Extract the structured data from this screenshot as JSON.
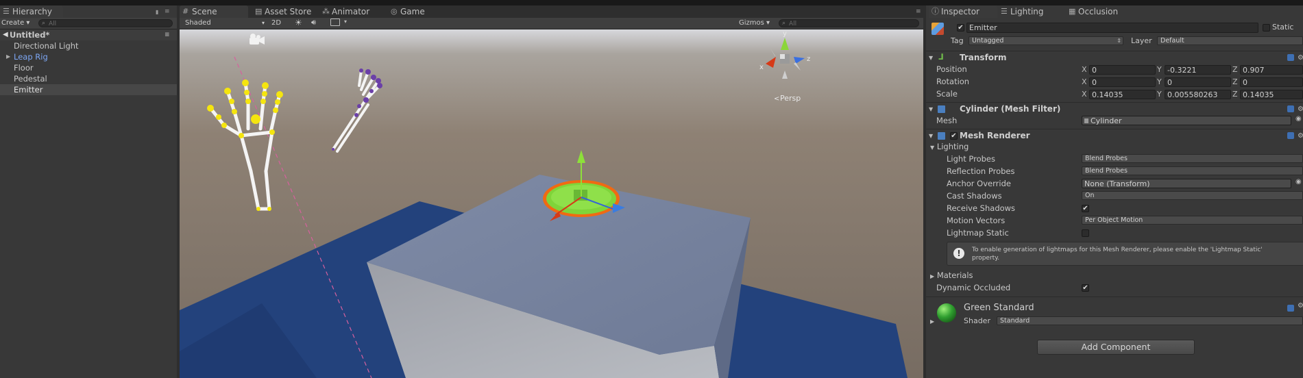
{
  "hierarchy": {
    "tab_label": "Hierarchy",
    "create_label": "Create",
    "search_placeholder": "All",
    "scene_name": "Untitled*",
    "items": [
      {
        "label": "Directional Light",
        "color": "#c8c8c8"
      },
      {
        "label": "Leap Rig",
        "color": "#7da7f5"
      },
      {
        "label": "Floor",
        "color": "#c8c8c8"
      },
      {
        "label": "Pedestal",
        "color": "#c8c8c8"
      },
      {
        "label": "Emitter",
        "color": "#e0e0e0"
      }
    ]
  },
  "scene_view": {
    "tabs": [
      "Scene",
      "Asset Store",
      "Animator",
      "Game"
    ],
    "shading_mode": "Shaded",
    "mode_2d": "2D",
    "gizmos_label": "Gizmos",
    "search_placeholder": "All",
    "projection_label": "Persp",
    "axes": {
      "y": "y",
      "x": "x",
      "z": "z"
    }
  },
  "inspector": {
    "tabs": [
      "Inspector",
      "Lighting",
      "Occlusion"
    ],
    "object_name": "Emitter",
    "static_label": "Static",
    "tag_label": "Tag",
    "tag_value": "Untagged",
    "layer_label": "Layer",
    "layer_value": "Default",
    "transform": {
      "title": "Transform",
      "position_label": "Position",
      "rotation_label": "Rotation",
      "scale_label": "Scale",
      "position": {
        "x": "0",
        "y": "-0.3221",
        "z": "0.907"
      },
      "rotation": {
        "x": "0",
        "y": "0",
        "z": "0"
      },
      "scale": {
        "x": "0.14035",
        "y": "0.005580263",
        "z": "0.14035"
      }
    },
    "mesh_filter": {
      "title": "Cylinder (Mesh Filter)",
      "mesh_label": "Mesh",
      "mesh_value": "Cylinder"
    },
    "mesh_renderer": {
      "title": "Mesh Renderer",
      "lighting_label": "Lighting",
      "light_probes_label": "Light Probes",
      "light_probes_value": "Blend Probes",
      "reflection_probes_label": "Reflection Probes",
      "reflection_probes_value": "Blend Probes",
      "anchor_override_label": "Anchor Override",
      "anchor_override_value": "None (Transform)",
      "cast_shadows_label": "Cast Shadows",
      "cast_shadows_value": "On",
      "receive_shadows_label": "Receive Shadows",
      "receive_shadows_checked": true,
      "motion_vectors_label": "Motion Vectors",
      "motion_vectors_value": "Per Object Motion",
      "lightmap_static_label": "Lightmap Static",
      "lightmap_static_checked": false,
      "info_message_line1": "To enable generation of lightmaps for this Mesh Renderer, please enable the 'Lightmap Static'",
      "info_message_line2": "property.",
      "materials_label": "Materials",
      "dynamic_occluded_label": "Dynamic Occluded",
      "dynamic_occluded_checked": true
    },
    "material": {
      "name": "Green Standard",
      "shader_label": "Shader",
      "shader_value": "Standard"
    },
    "add_component_label": "Add Component"
  },
  "colors": {
    "accent_blue": "#3e6fb3",
    "selection": "#474747",
    "green_material": "#2f9e2f"
  }
}
